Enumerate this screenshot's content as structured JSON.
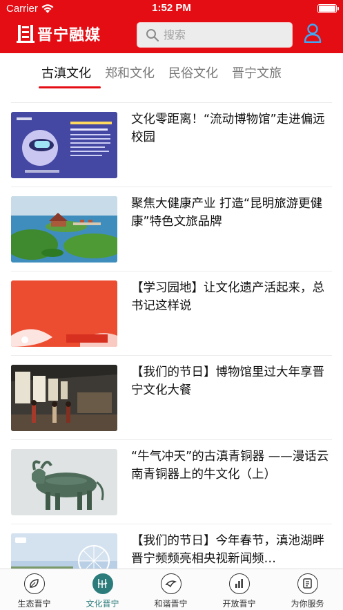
{
  "status_bar": {
    "carrier": "Carrier",
    "time": "1:52 PM"
  },
  "header": {
    "logo_text": "晋宁融媒",
    "search_placeholder": "搜索",
    "icons": {
      "search": "search-icon",
      "user": "user-icon",
      "wifi": "wifi-icon",
      "battery": "battery-icon"
    },
    "brand_color": "#e40d14"
  },
  "tabs": [
    {
      "label": "古滇文化",
      "active": true
    },
    {
      "label": "郑和文化",
      "active": false
    },
    {
      "label": "民俗文化",
      "active": false
    },
    {
      "label": "晋宁文旅",
      "active": false
    }
  ],
  "articles": [
    {
      "title": "文化零距离！“流动博物馆”走进偏远校园",
      "thumb": "museum-vr-poster"
    },
    {
      "title": "聚焦大健康产业 打造“昆明旅游更健康”特色文旅品牌",
      "thumb": "lake-resort-aerial"
    },
    {
      "title": "【学习园地】让文化遗产活起来，总书记这样说",
      "thumb": "study-garden-banner"
    },
    {
      "title": "【我们的节日】博物馆里过大年享晋宁文化大餐",
      "thumb": "museum-gallery-visitors"
    },
    {
      "title": "“牛气冲天”的古滇青铜器 ——漫话云南青铜器上的牛文化（上）",
      "thumb": "bronze-ox-statue"
    },
    {
      "title": "【我们的节日】今年春节，滇池湖畔晋宁频频亮相央视新闻频…",
      "thumb": "cctv-ferris-wheel"
    }
  ],
  "tabbar": {
    "accent_color": "#2d7c7c",
    "items": [
      {
        "label": "生态晋宁",
        "icon": "leaf-icon",
        "active": false
      },
      {
        "label": "文化晋宁",
        "icon": "culture-icon",
        "active": true
      },
      {
        "label": "和谐晋宁",
        "icon": "bird-icon",
        "active": false
      },
      {
        "label": "开放晋宁",
        "icon": "chart-icon",
        "active": false
      },
      {
        "label": "为你服务",
        "icon": "service-icon",
        "active": false
      }
    ]
  }
}
